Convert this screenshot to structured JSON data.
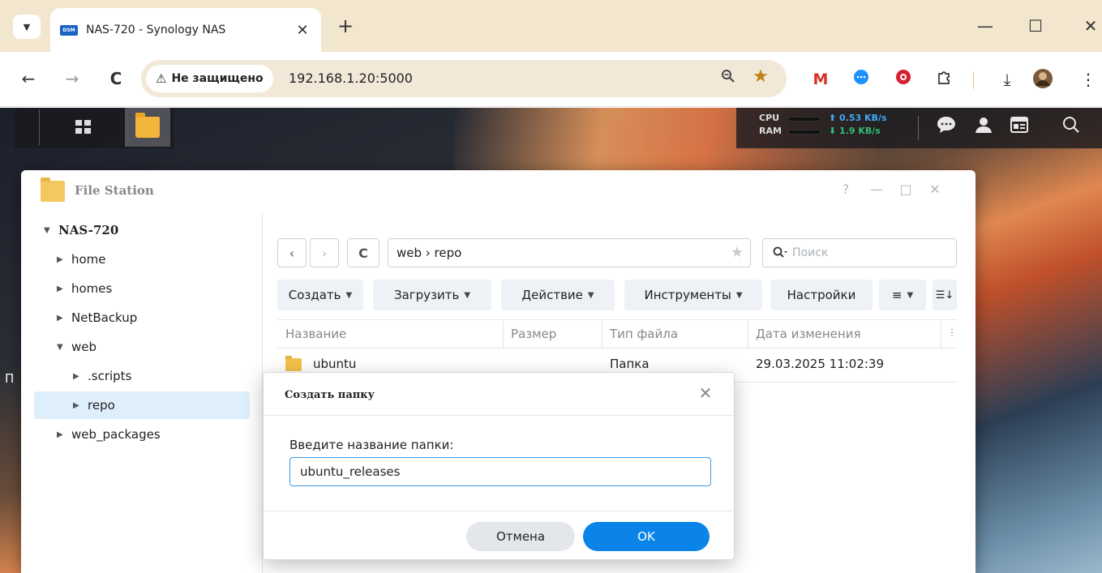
{
  "browser": {
    "tab_menu_icon": "chevron-down",
    "tab_favicon": "DSM",
    "tab_title": "NAS-720 - Synology NAS",
    "tab_close": "✕",
    "new_tab": "+",
    "minimize": "—",
    "maximize": "☐",
    "close": "✕",
    "back": "←",
    "forward": "→",
    "reload": "C",
    "security_warning_icon": "⚠",
    "security_label": "Не защищено",
    "url": "192.168.1.20:5000",
    "zoom_icon": "magnifier",
    "bookmark_icon": "★",
    "download_icon": "⤓",
    "menu_icon": "⋮"
  },
  "dsm": {
    "cpu_label": "CPU",
    "ram_label": "RAM",
    "upload_speed": "⬆ 0.53 KB/s",
    "download_speed": "⬇ 1.9 KB/s",
    "upload_color": "#3fa9f5",
    "download_color": "#2dbf7a",
    "desktop_fragment": "П"
  },
  "file_station": {
    "title": "File Station",
    "help": "?",
    "minimize": "—",
    "maximize": "□",
    "close": "✕",
    "tree": {
      "root": "NAS-720",
      "items": [
        {
          "label": "home",
          "expanded": false
        },
        {
          "label": "homes",
          "expanded": false
        },
        {
          "label": "NetBackup",
          "expanded": false
        },
        {
          "label": "web",
          "expanded": true
        },
        {
          "label": ".scripts",
          "expanded": false
        },
        {
          "label": "repo",
          "expanded": false,
          "selected": true
        },
        {
          "label": "web_packages",
          "expanded": false
        }
      ]
    },
    "path": "web › repo",
    "search_placeholder": "Поиск",
    "actions": [
      "Создать",
      "Загрузить",
      "Действие",
      "Инструменты",
      "Настройки"
    ],
    "columns": [
      "Название",
      "Размер",
      "Тип файла",
      "Дата изменения"
    ],
    "rows": [
      {
        "name": "ubuntu",
        "size": "",
        "type": "Папка",
        "modified": "29.03.2025 11:02:39"
      }
    ]
  },
  "dialog": {
    "title": "Создать папку",
    "close": "✕",
    "label": "Введите название папки:",
    "input_value": "ubuntu_releases",
    "cancel_label": "Отмена",
    "ok_label": "OK",
    "accent": "#0a84e8"
  }
}
